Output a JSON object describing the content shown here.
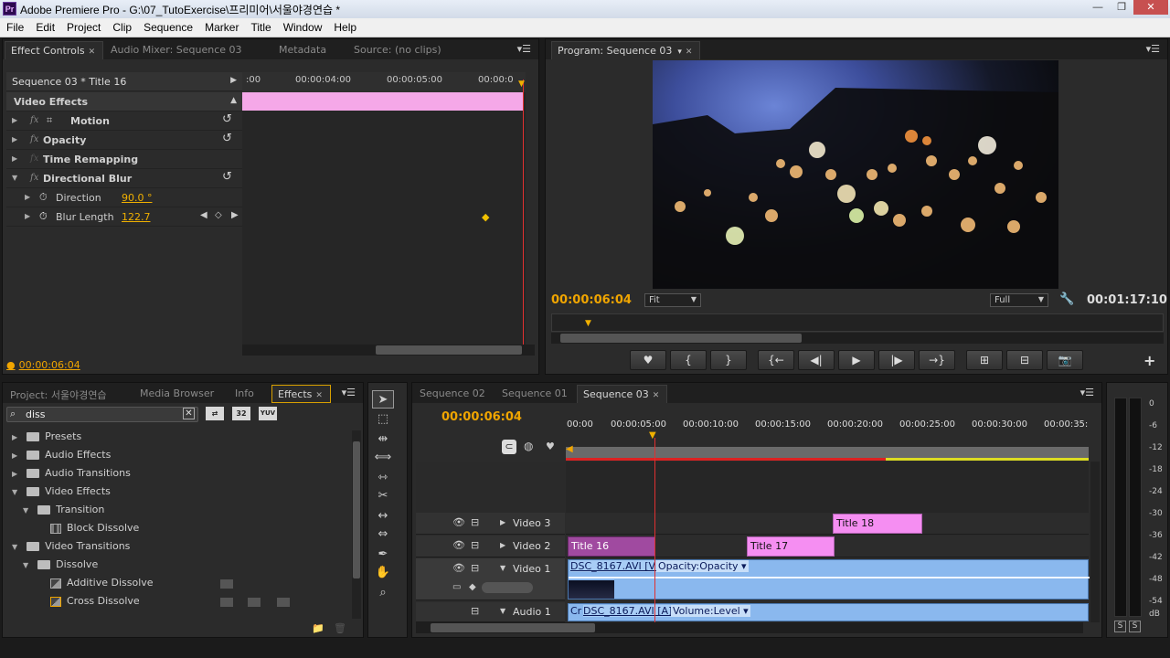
{
  "titlebar": {
    "logo": "Pr",
    "title": "Adobe Premiere Pro - G:\\07_TutoExercise\\프리미어\\서울야경연습 *",
    "min": "—",
    "max": "❐",
    "close": "✕"
  },
  "menu": [
    "File",
    "Edit",
    "Project",
    "Clip",
    "Sequence",
    "Marker",
    "Title",
    "Window",
    "Help"
  ],
  "effect_controls": {
    "tabs": [
      "Effect Controls",
      "Audio Mixer: Sequence 03",
      "Metadata",
      "Source: (no clips)"
    ],
    "clip_name": "Sequence 03 * Title 16",
    "ruler": [
      ":00",
      "00:00:04:00",
      "00:00:05:00",
      "00:00:0"
    ],
    "section": "Video Effects",
    "effects": [
      {
        "name": "Motion",
        "fx": "fx"
      },
      {
        "name": "Opacity",
        "fx": "fx"
      },
      {
        "name": "Time Remapping",
        "fx": "fx"
      },
      {
        "name": "Directional Blur",
        "fx": "fx"
      }
    ],
    "params": [
      {
        "name": "Direction",
        "value": "90.0 °"
      },
      {
        "name": "Blur Length",
        "value": "122.7"
      }
    ],
    "timecode": "00:00:06:04"
  },
  "program": {
    "tab": "Program: Sequence 03",
    "timecode": "00:00:06:04",
    "fit": "Fit",
    "quality": "Full",
    "duration": "00:01:17:10",
    "buttons": [
      "♥",
      "{",
      "}",
      "{←",
      "◀|",
      "▶",
      "|▶",
      "→}",
      "⊞",
      "⊟",
      "📷"
    ],
    "add": "+"
  },
  "project": {
    "tabs": [
      "Project: 서울야경연습",
      "Media Browser",
      "Info",
      "Effects"
    ],
    "search": "diss",
    "badges": [
      "⇄",
      "32",
      "YUV"
    ],
    "tree": [
      {
        "label": "Presets",
        "level": 0,
        "type": "folder",
        "open": false
      },
      {
        "label": "Audio Effects",
        "level": 0,
        "type": "folder",
        "open": false
      },
      {
        "label": "Audio Transitions",
        "level": 0,
        "type": "folder",
        "open": false
      },
      {
        "label": "Video Effects",
        "level": 0,
        "type": "folder",
        "open": true
      },
      {
        "label": "Transition",
        "level": 1,
        "type": "folder",
        "open": true
      },
      {
        "label": "Block Dissolve",
        "level": 2,
        "type": "effect"
      },
      {
        "label": "Video Transitions",
        "level": 0,
        "type": "folder",
        "open": true
      },
      {
        "label": "Dissolve",
        "level": 1,
        "type": "folder",
        "open": true
      },
      {
        "label": "Additive Dissolve",
        "level": 2,
        "type": "effect"
      },
      {
        "label": "Cross Dissolve",
        "level": 2,
        "type": "effect"
      }
    ]
  },
  "timeline": {
    "tabs": [
      "Sequence 02",
      "Sequence 01",
      "Sequence 03"
    ],
    "timecode": "00:00:06:04",
    "ruler": [
      "00:00",
      "00:00:05:00",
      "00:00:10:00",
      "00:00:15:00",
      "00:00:20:00",
      "00:00:25:00",
      "00:00:30:00",
      "00:00:35:"
    ],
    "tracks": [
      {
        "name": "Video 3"
      },
      {
        "name": "Video 2"
      },
      {
        "name": "Video 1"
      },
      {
        "name": "Audio 1"
      }
    ],
    "clips": {
      "title18": "Title 18",
      "title16": "Title 16",
      "title17": "Title 17",
      "video1": "DSC_8167.AVI [V]",
      "video1_fx": "Opacity:Opacity ▾",
      "audio1_a": "Cr",
      "audio1": "DSC_8167.AVI [A]",
      "audio1_fx": "Volume:Level ▾"
    }
  },
  "meter": {
    "labels": [
      "0",
      "-6",
      "-12",
      "-18",
      "-24",
      "-30",
      "-36",
      "-42",
      "-48",
      "-54",
      "dB"
    ],
    "solo": [
      "S",
      "S"
    ]
  },
  "colors": {
    "accent": "#f0a500",
    "title_clip": "#f58ef2",
    "video_clip": "#8ab8ee",
    "playhead": "#e03030"
  }
}
